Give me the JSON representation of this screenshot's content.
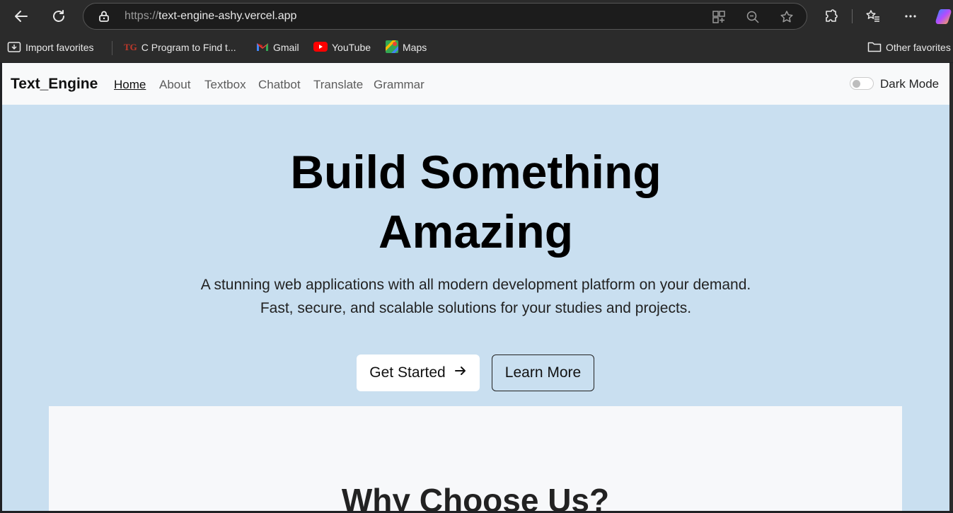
{
  "browser": {
    "url_protocol": "https://",
    "url_host": "text-engine-ashy.vercel.app",
    "bookmarks": [
      {
        "label": "Import favorites",
        "icon": "import-icon"
      },
      {
        "label": "C Program to Find t...",
        "icon": "tg-favicon"
      },
      {
        "label": "Gmail",
        "icon": "gmail-icon"
      },
      {
        "label": "YouTube",
        "icon": "youtube-icon"
      },
      {
        "label": "Maps",
        "icon": "maps-icon"
      }
    ],
    "other_favorites": "Other favorites"
  },
  "navbar": {
    "brand": "Text_Engine",
    "links": [
      {
        "label": "Home"
      },
      {
        "label": "About"
      },
      {
        "label": "Textbox"
      },
      {
        "label": "Chatbot"
      },
      {
        "label": "Translate"
      },
      {
        "label": "Grammar"
      }
    ],
    "dark_mode_label": "Dark Mode"
  },
  "hero": {
    "title_line1": "Build Something",
    "title_line2": "Amazing",
    "subtitle_line1": "A stunning web applications with all modern development platform on your demand.",
    "subtitle_line2": "Fast, secure, and scalable solutions for your studies and projects.",
    "primary_button": "Get Started",
    "secondary_button": "Learn More"
  },
  "section": {
    "title": "Why Choose Us?"
  },
  "colors": {
    "hero_bg": "#c9dff0",
    "navbar_bg": "#f8f9fa",
    "chrome_bg": "#2b2b2b"
  }
}
